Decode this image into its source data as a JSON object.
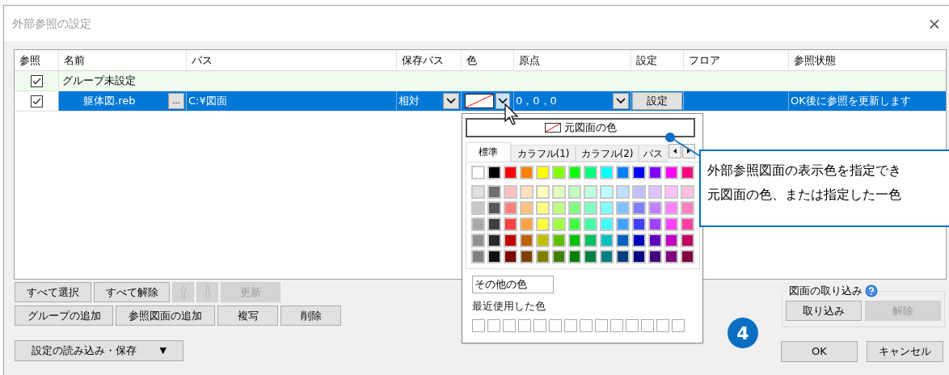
{
  "window": {
    "title": "外部参照の設定",
    "close": "×"
  },
  "table": {
    "columns": [
      "参照",
      "名前",
      "パス",
      "保存パス",
      "色",
      "原点",
      "設定",
      "フロア",
      "参照状態"
    ],
    "rows": [
      {
        "kind": "group",
        "checked": true,
        "selected": false,
        "name": "グループ未設定"
      },
      {
        "kind": "item",
        "checked": true,
        "selected": true,
        "name": "躯体図.reb",
        "browse": "...",
        "path": "C:¥図面",
        "save_path": "相対",
        "origin": "0，0，0",
        "setting": "設定",
        "status": "OK後に参照を更新します"
      }
    ]
  },
  "color_popup": {
    "original_color": "元図面の色",
    "tabs": [
      {
        "label": "標準",
        "selected": true
      },
      {
        "label": "カラフル(1)",
        "selected": false
      },
      {
        "label": "カラフル(2)",
        "selected": false
      },
      {
        "label": "パス",
        "selected": false
      }
    ],
    "palette": [
      {
        "swatches": [
          {
            "color": "#ffffff"
          },
          {
            "color": "#000000"
          },
          {
            "color": "#ff0000"
          },
          {
            "color": "#ff8000"
          },
          {
            "color": "#ffff00"
          },
          {
            "color": "#80ff00"
          },
          {
            "color": "#00ff00"
          },
          {
            "color": "#00ff80"
          },
          {
            "color": "#00ffff"
          },
          {
            "color": "#0080ff"
          },
          {
            "color": "#0000ff"
          },
          {
            "color": "#8000ff"
          },
          {
            "color": "#ff00ff"
          },
          {
            "color": "#ff0080"
          }
        ]
      },
      {
        "swatches": [
          {
            "color": "#e0e0e0"
          },
          {
            "color": "#707070"
          },
          {
            "color": "#ffc0c0"
          },
          {
            "color": "#ffe0c0"
          },
          {
            "color": "#ffffc0"
          },
          {
            "color": "#e0ffc0"
          },
          {
            "color": "#c0ffc0"
          },
          {
            "color": "#c0ffe0"
          },
          {
            "color": "#c0ffff"
          },
          {
            "color": "#c0e0ff"
          },
          {
            "color": "#c0c0ff"
          },
          {
            "color": "#e0c0ff"
          },
          {
            "color": "#ffc0ff"
          },
          {
            "color": "#ffc0e0"
          }
        ]
      },
      {
        "swatches": [
          {
            "color": "#c8c8c8"
          },
          {
            "color": "#585858"
          },
          {
            "color": "#ff8080"
          },
          {
            "color": "#ffc080"
          },
          {
            "color": "#ffff80"
          },
          {
            "color": "#c0ff80"
          },
          {
            "color": "#80ff80"
          },
          {
            "color": "#80ffc0"
          },
          {
            "color": "#80ffff"
          },
          {
            "color": "#80c0ff"
          },
          {
            "color": "#8080ff"
          },
          {
            "color": "#c080ff"
          },
          {
            "color": "#ff80ff"
          },
          {
            "color": "#ff80c0"
          }
        ]
      },
      {
        "swatches": [
          {
            "color": "#a8a8a8"
          },
          {
            "color": "#404040"
          },
          {
            "color": "#ff4040"
          },
          {
            "color": "#ffa040"
          },
          {
            "color": "#ffff40"
          },
          {
            "color": "#a0ff40"
          },
          {
            "color": "#40ff40"
          },
          {
            "color": "#40ffa0"
          },
          {
            "color": "#40ffff"
          },
          {
            "color": "#40a0ff"
          },
          {
            "color": "#4040ff"
          },
          {
            "color": "#a040ff"
          },
          {
            "color": "#ff40ff"
          },
          {
            "color": "#ff40a0"
          }
        ]
      },
      {
        "swatches": [
          {
            "color": "#909090"
          },
          {
            "color": "#282828"
          },
          {
            "color": "#c00000"
          },
          {
            "color": "#c06000"
          },
          {
            "color": "#c0c000"
          },
          {
            "color": "#60c000"
          },
          {
            "color": "#00c000"
          },
          {
            "color": "#00c060"
          },
          {
            "color": "#00c0c0"
          },
          {
            "color": "#0060c0"
          },
          {
            "color": "#0000c0"
          },
          {
            "color": "#6000c0"
          },
          {
            "color": "#c000c0"
          },
          {
            "color": "#c00060"
          }
        ]
      },
      {
        "swatches": [
          {
            "color": "#808080"
          },
          {
            "color": "#101010"
          },
          {
            "color": "#800000"
          },
          {
            "color": "#804000"
          },
          {
            "color": "#808000"
          },
          {
            "color": "#408000"
          },
          {
            "color": "#008000"
          },
          {
            "color": "#008040"
          },
          {
            "color": "#008080"
          },
          {
            "color": "#004080"
          },
          {
            "color": "#000080"
          },
          {
            "color": "#400080"
          },
          {
            "color": "#800080"
          },
          {
            "color": "#800040"
          }
        ]
      }
    ],
    "other_colors": "その他の色",
    "recent_label": "最近使用した色",
    "recent": [
      {
        "color": "#ffffff"
      },
      {
        "color": "#ffffff"
      },
      {
        "color": "#ffffff"
      },
      {
        "color": "#ffffff"
      },
      {
        "color": "#ffffff"
      },
      {
        "color": "#ffffff"
      },
      {
        "color": "#ffffff"
      },
      {
        "color": "#ffffff"
      },
      {
        "color": "#ffffff"
      },
      {
        "color": "#ffffff"
      },
      {
        "color": "#ffffff"
      },
      {
        "color": "#ffffff"
      },
      {
        "color": "#ffffff"
      },
      {
        "color": "#ffffff"
      }
    ]
  },
  "callout": {
    "lines": [
      "外部参照図面の表示色を指定でき",
      "元図面の色、または指定した一色"
    ]
  },
  "step_badge": "4",
  "toolbar": [
    [
      {
        "kind": "text",
        "label": "すべて選択",
        "disabled": false
      },
      {
        "kind": "text",
        "label": "すべて解除",
        "disabled": false
      },
      {
        "kind": "up",
        "disabled": true
      },
      {
        "kind": "down",
        "disabled": true
      },
      {
        "kind": "text",
        "label": "更新",
        "disabled": true
      }
    ],
    [
      {
        "kind": "text",
        "label": "グループの追加",
        "disabled": false
      },
      {
        "kind": "text",
        "label": "参照図面の追加",
        "disabled": false
      },
      {
        "kind": "text",
        "label": "複写",
        "disabled": false
      },
      {
        "kind": "text",
        "label": "削除",
        "disabled": false
      }
    ]
  ],
  "settings_menu": {
    "label": "設定の読み込み・保存",
    "arrow": "▼"
  },
  "import_group": {
    "title": "図面の取り込み",
    "buttons": [
      {
        "label": "取り込み",
        "disabled": false
      },
      {
        "label": "解除",
        "disabled": true
      }
    ]
  },
  "buttons": [
    "OK",
    "キャンセル"
  ]
}
